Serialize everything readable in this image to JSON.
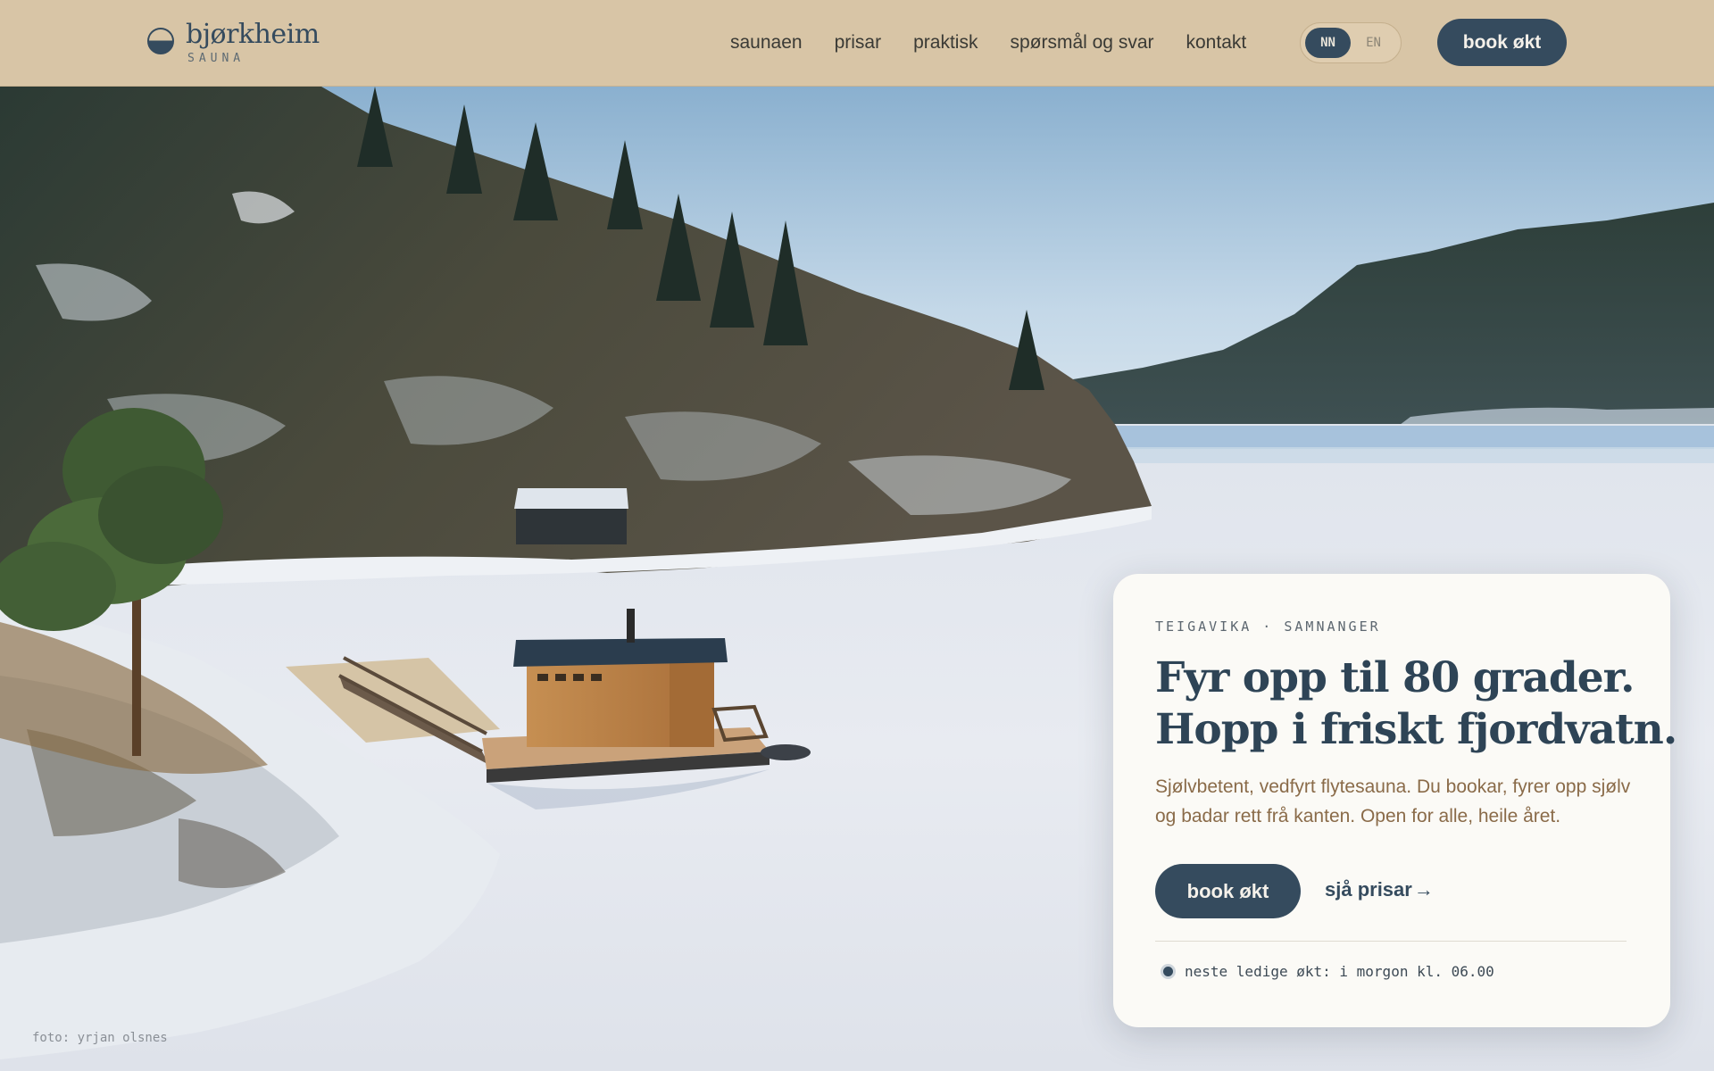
{
  "brand": {
    "name": "bjørkheim",
    "subtitle": "SAUNA",
    "logo_icon": "half-filled-circle-icon"
  },
  "nav": {
    "items": [
      {
        "label": "saunaen"
      },
      {
        "label": "prisar"
      },
      {
        "label": "praktisk"
      },
      {
        "label": "spørsmål og svar"
      },
      {
        "label": "kontakt"
      }
    ]
  },
  "language": {
    "options": [
      "NN",
      "EN"
    ],
    "selected": "NN"
  },
  "header": {
    "book_label": "book økt"
  },
  "hero": {
    "eyebrow": "TEIGAVIKA · SAMNANGER",
    "headline_line1": "Fyr opp til 80 grader.",
    "headline_line2": "Hopp i friskt fjordvatn.",
    "description": "Sjølvbetent, vedfyrt flytesauna. Du bookar, fyrer opp sjølv og badar rett frå kanten. Open for alle, heile året.",
    "book_label": "book økt",
    "prices_label": "sjå prisar",
    "prices_arrow": "→",
    "status_text": "neste ledige økt: i morgon kl. 06.00",
    "photo_credit": "foto: yrjan olsnes"
  },
  "colors": {
    "header_bg": "#d8c5a6",
    "accent": "#354b5e",
    "card_bg": "#fbfaf6",
    "body_text": "#8a6b49"
  }
}
